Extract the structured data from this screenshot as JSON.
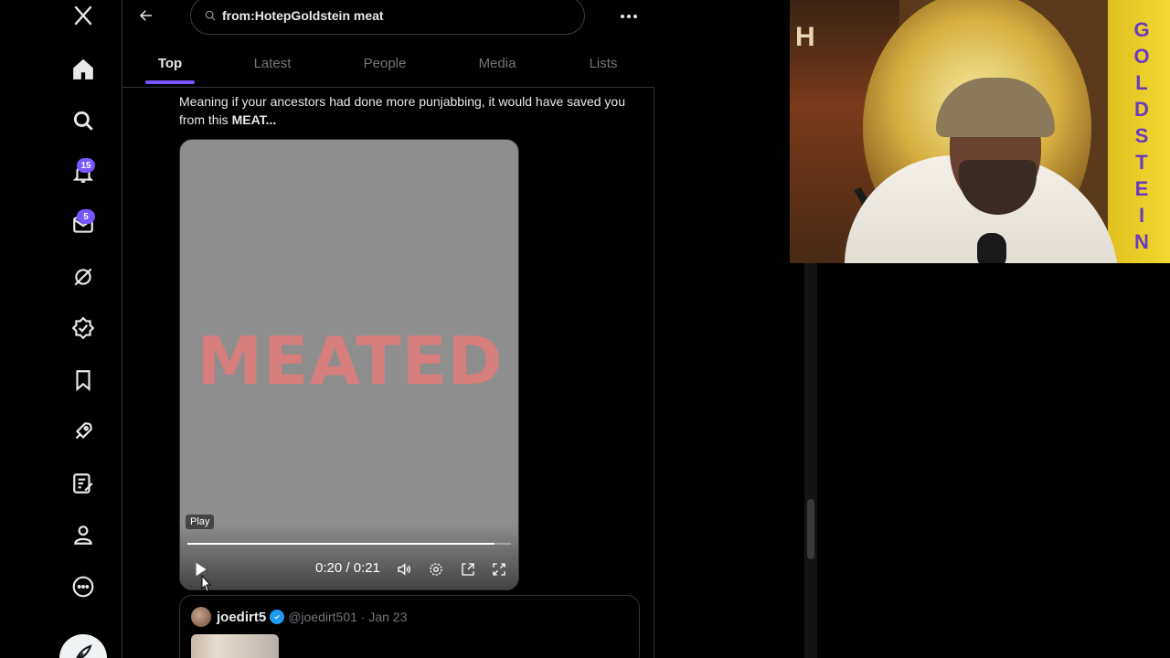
{
  "nav": {
    "logo": "x-logo-icon",
    "notifications_badge": "15",
    "messages_badge": "5",
    "items": [
      "home-icon",
      "explore-icon",
      "notifications-icon",
      "messages-icon",
      "grok-icon",
      "verified-icon",
      "bookmarks-icon",
      "rocket-icon",
      "articles-icon",
      "profile-icon",
      "more-icon",
      "compose-icon"
    ]
  },
  "search": {
    "query": "from:HotepGoldstein meat"
  },
  "tabs": [
    {
      "label": "Top"
    },
    {
      "label": "Latest"
    },
    {
      "label": "People"
    },
    {
      "label": "Media"
    },
    {
      "label": "Lists"
    }
  ],
  "post": {
    "text_prefix": "Meaning if your ancestors had done more punjabbing, it  would have saved you from this ",
    "text_bold": "MEAT...",
    "video": {
      "overlay_text": "MEATED",
      "tooltip": "Play",
      "time": "0:20 / 0:21",
      "progress_percent": 95
    }
  },
  "quote": {
    "name": "joedirt5",
    "handle_date": "@joedirt501 · Jan 23"
  },
  "webcam": {
    "banner_letters": "GOLDSTEIN",
    "corner_letter": "H"
  },
  "colors": {
    "accent": "#7856ff",
    "verified": "#1d9bf0",
    "meated_text": "#e47d7a"
  }
}
